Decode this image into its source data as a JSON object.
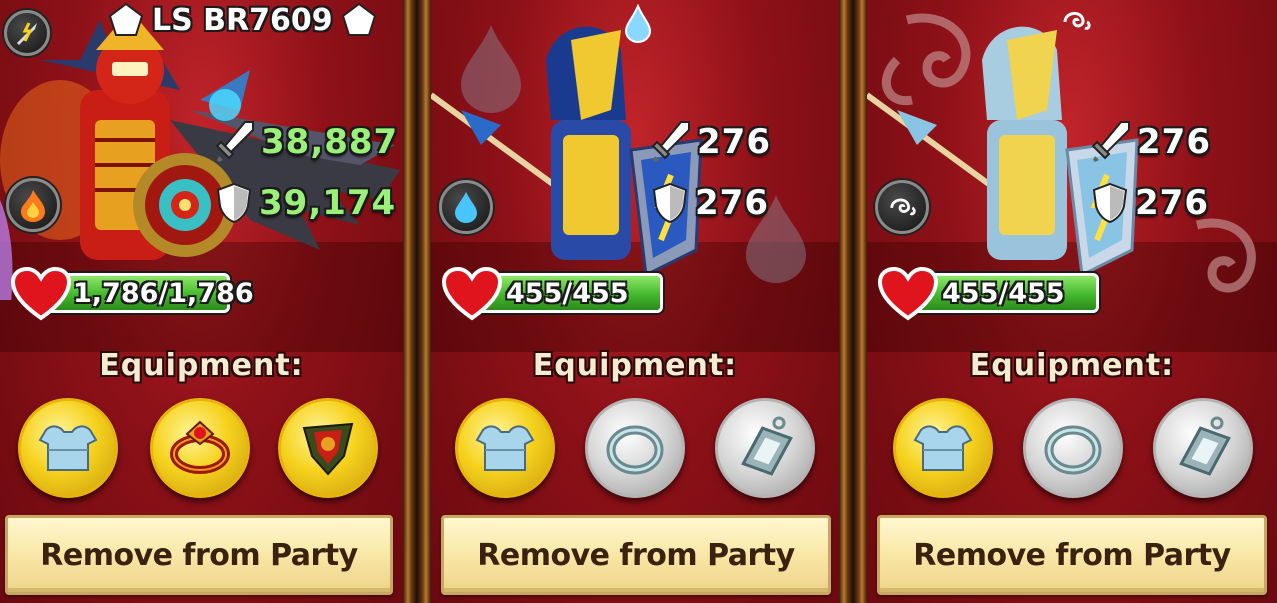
{
  "panels": [
    {
      "hero_name": "LS BR7609",
      "element": "fire",
      "element_icon": "fire-icon",
      "attack": "38,887",
      "defense": "39,174",
      "hp": "1,786/1,786",
      "hp_fraction": 1.0,
      "equipment_label": "Equipment:",
      "equipment": [
        {
          "icon": "armor-icon",
          "style": "gold"
        },
        {
          "icon": "ring-icon",
          "style": "gold"
        },
        {
          "icon": "amulet-icon",
          "style": "gold"
        }
      ],
      "button_label": "Remove from Party"
    },
    {
      "element": "water",
      "element_icon": "water-drop-icon",
      "attack": "276",
      "defense": "276",
      "hp": "455/455",
      "hp_fraction": 1.0,
      "equipment_label": "Equipment:",
      "equipment": [
        {
          "icon": "armor-icon",
          "style": "gold"
        },
        {
          "icon": "ring-icon",
          "style": "silver"
        },
        {
          "icon": "amulet-icon",
          "style": "silver"
        }
      ],
      "button_label": "Remove from Party"
    },
    {
      "element": "wind",
      "element_icon": "wind-swirl-icon",
      "attack": "276",
      "defense": "276",
      "hp": "455/455",
      "hp_fraction": 1.0,
      "equipment_label": "Equipment:",
      "equipment": [
        {
          "icon": "armor-icon",
          "style": "gold"
        },
        {
          "icon": "ring-icon",
          "style": "silver"
        },
        {
          "icon": "amulet-icon",
          "style": "silver"
        }
      ],
      "button_label": "Remove from Party"
    }
  ],
  "colors": {
    "panel_red": "#8e1118",
    "hp_green": "#44b82c",
    "attack_green": "#9bf07a",
    "button_cream": "#f8e7a6",
    "gold_slot": "#f6d21e",
    "silver_slot": "#d4d4d4"
  }
}
